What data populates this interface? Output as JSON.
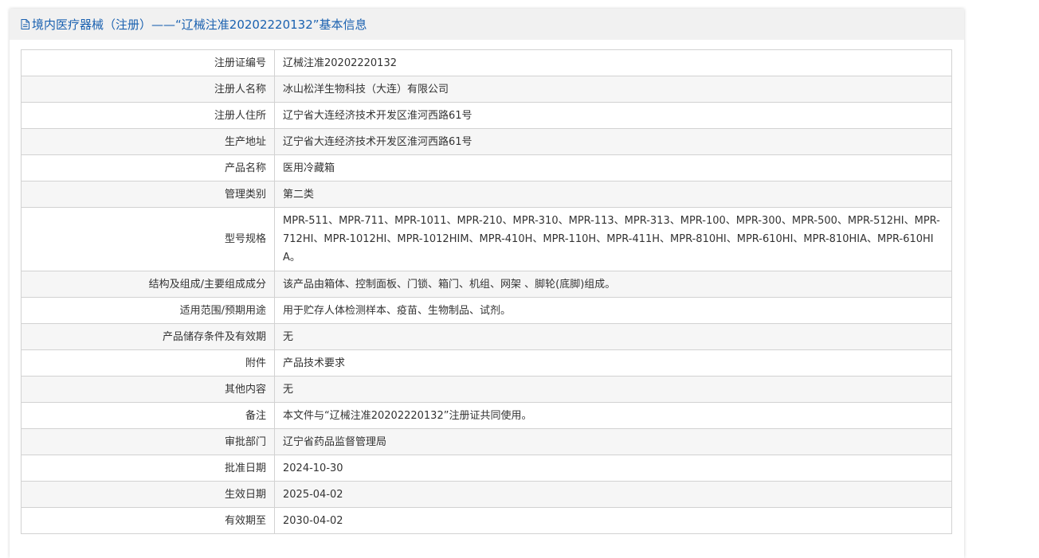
{
  "header": {
    "title": "境内医疗器械（注册）——“辽械注准20202220132”基本信息",
    "icon": "document-icon",
    "title_color": "#1a61b0"
  },
  "rows": [
    {
      "label": "注册证编号",
      "value": "辽械注准20202220132"
    },
    {
      "label": "注册人名称",
      "value": "冰山松洋生物科技（大连）有限公司"
    },
    {
      "label": "注册人住所",
      "value": "辽宁省大连经济技术开发区淮河西路61号"
    },
    {
      "label": "生产地址",
      "value": "辽宁省大连经济技术开发区淮河西路61号"
    },
    {
      "label": "产品名称",
      "value": "医用冷藏箱"
    },
    {
      "label": "管理类别",
      "value": "第二类"
    },
    {
      "label": "型号规格",
      "value": "MPR-511、MPR-711、MPR-1011、MPR-210、MPR-310、MPR-113、MPR-313、MPR-100、MPR-300、MPR-500、MPR-512HI、MPR-712HI、MPR-1012HI、MPR-1012HIM、MPR-410H、MPR-110H、MPR-411H、MPR-810HI、MPR-610HI、MPR-810HIA、MPR-610HIA。"
    },
    {
      "label": "结构及组成/主要组成成分",
      "value": "该产品由箱体、控制面板、门锁、箱门、机组、网架 、脚轮(底脚)组成。"
    },
    {
      "label": "适用范围/预期用途",
      "value": "用于贮存人体检测样本、疫苗、生物制品、试剂。"
    },
    {
      "label": "产品储存条件及有效期",
      "value": "无"
    },
    {
      "label": "附件",
      "value": "产品技术要求"
    },
    {
      "label": "其他内容",
      "value": "无"
    },
    {
      "label": "备注",
      "value": "本文件与“辽械注准20202220132”注册证共同使用。"
    },
    {
      "label": "审批部门",
      "value": "辽宁省药品监督管理局"
    },
    {
      "label": "批准日期",
      "value": "2024-10-30"
    },
    {
      "label": "生效日期",
      "value": "2025-04-02"
    },
    {
      "label": "有效期至",
      "value": "2030-04-02"
    }
  ]
}
